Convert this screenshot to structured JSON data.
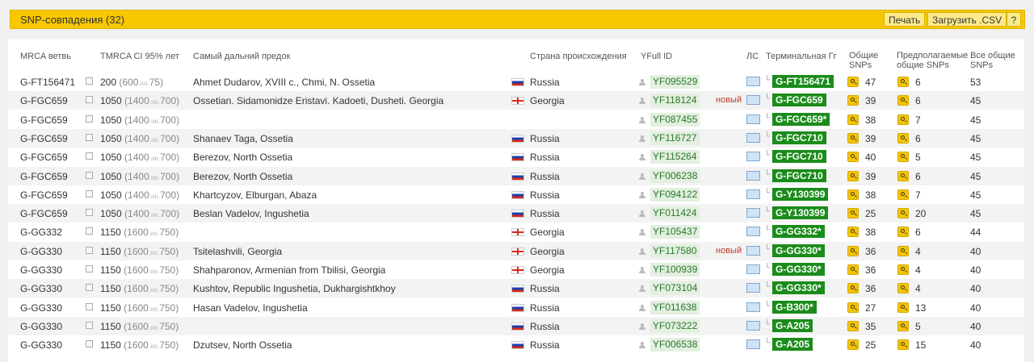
{
  "header": {
    "title": "SNP-совпадения (32)",
    "print_label": "Печать",
    "csv_label": "Загрузить .CSV",
    "help_label": "?"
  },
  "columns": {
    "mrca": "MRCA ветвь",
    "tmrca": "TMRCA CI 95% лет",
    "ancestor": "Самый дальний предок",
    "country": "Страна происхождения",
    "yfull": "YFull ID",
    "ls": "ЛС",
    "terminal": "Терминальная Гг",
    "shared1": "Общие",
    "shared2": "SNPs",
    "assumed1": "Предполагаемые",
    "assumed2": "общие SNPs",
    "all1": "Все общие",
    "all2": "SNPs"
  },
  "rows": [
    {
      "mrca": "G-FT156471",
      "tmrca": "200",
      "ci": "(600",
      "ci_end": "75)",
      "ancestor": "Ahmet Dudarov, XVIII c., Chmi, N. Ossetia",
      "country": "Russia",
      "flag": "ru",
      "yfull": "YF095529",
      "new": "",
      "hg": "G-FT156471",
      "shared": "47",
      "assumed": "6",
      "all": "53"
    },
    {
      "mrca": "G-FGC659",
      "tmrca": "1050",
      "ci": "(1400",
      "ci_end": "700)",
      "ancestor": "Ossetian. Sidamonidze Eristavi. Kadoeti, Dusheti. Georgia",
      "country": "Georgia",
      "flag": "ge",
      "yfull": "YF118124",
      "new": "новый",
      "hg": "G-FGC659",
      "shared": "39",
      "assumed": "6",
      "all": "45"
    },
    {
      "mrca": "G-FGC659",
      "tmrca": "1050",
      "ci": "(1400",
      "ci_end": "700)",
      "ancestor": "",
      "country": "",
      "flag": "",
      "yfull": "YF087455",
      "new": "",
      "hg": "G-FGC659*",
      "shared": "38",
      "assumed": "7",
      "all": "45"
    },
    {
      "mrca": "G-FGC659",
      "tmrca": "1050",
      "ci": "(1400",
      "ci_end": "700)",
      "ancestor": "Shanaev Taga, Ossetia",
      "country": "Russia",
      "flag": "ru",
      "yfull": "YF116727",
      "new": "",
      "hg": "G-FGC710",
      "shared": "39",
      "assumed": "6",
      "all": "45"
    },
    {
      "mrca": "G-FGC659",
      "tmrca": "1050",
      "ci": "(1400",
      "ci_end": "700)",
      "ancestor": "Berezov, North Ossetia",
      "country": "Russia",
      "flag": "ru",
      "yfull": "YF115264",
      "new": "",
      "hg": "G-FGC710",
      "shared": "40",
      "assumed": "5",
      "all": "45"
    },
    {
      "mrca": "G-FGC659",
      "tmrca": "1050",
      "ci": "(1400",
      "ci_end": "700)",
      "ancestor": "Berezov, North Ossetia",
      "country": "Russia",
      "flag": "ru",
      "yfull": "YF006238",
      "new": "",
      "hg": "G-FGC710",
      "shared": "39",
      "assumed": "6",
      "all": "45"
    },
    {
      "mrca": "G-FGC659",
      "tmrca": "1050",
      "ci": "(1400",
      "ci_end": "700)",
      "ancestor": "Khartcyzov, Elburgan, Abaza",
      "country": "Russia",
      "flag": "ru",
      "yfull": "YF094122",
      "new": "",
      "hg": "G-Y130399",
      "shared": "38",
      "assumed": "7",
      "all": "45"
    },
    {
      "mrca": "G-FGC659",
      "tmrca": "1050",
      "ci": "(1400",
      "ci_end": "700)",
      "ancestor": "Beslan Vadelov, Ingushetia",
      "country": "Russia",
      "flag": "ru",
      "yfull": "YF011424",
      "new": "",
      "hg": "G-Y130399",
      "shared": "25",
      "assumed": "20",
      "all": "45"
    },
    {
      "mrca": "G-GG332",
      "tmrca": "1150",
      "ci": "(1600",
      "ci_end": "750)",
      "ancestor": "",
      "country": "Georgia",
      "flag": "ge",
      "yfull": "YF105437",
      "new": "",
      "hg": "G-GG332*",
      "shared": "38",
      "assumed": "6",
      "all": "44"
    },
    {
      "mrca": "G-GG330",
      "tmrca": "1150",
      "ci": "(1600",
      "ci_end": "750)",
      "ancestor": "Tsitelashvili, Georgia",
      "country": "Georgia",
      "flag": "ge",
      "yfull": "YF117580",
      "new": "новый",
      "hg": "G-GG330*",
      "shared": "36",
      "assumed": "4",
      "all": "40"
    },
    {
      "mrca": "G-GG330",
      "tmrca": "1150",
      "ci": "(1600",
      "ci_end": "750)",
      "ancestor": "Shahparonov, Armenian from Tbilisi, Georgia",
      "country": "Georgia",
      "flag": "ge",
      "yfull": "YF100939",
      "new": "",
      "hg": "G-GG330*",
      "shared": "36",
      "assumed": "4",
      "all": "40"
    },
    {
      "mrca": "G-GG330",
      "tmrca": "1150",
      "ci": "(1600",
      "ci_end": "750)",
      "ancestor": "Kushtov, Republic Ingushetia, Dukhargishtkhoy",
      "country": "Russia",
      "flag": "ru",
      "yfull": "YF073104",
      "new": "",
      "hg": "G-GG330*",
      "shared": "36",
      "assumed": "4",
      "all": "40"
    },
    {
      "mrca": "G-GG330",
      "tmrca": "1150",
      "ci": "(1600",
      "ci_end": "750)",
      "ancestor": "Hasan Vadelov, Ingushetia",
      "country": "Russia",
      "flag": "ru",
      "yfull": "YF011638",
      "new": "",
      "hg": "G-B300*",
      "shared": "27",
      "assumed": "13",
      "all": "40"
    },
    {
      "mrca": "G-GG330",
      "tmrca": "1150",
      "ci": "(1600",
      "ci_end": "750)",
      "ancestor": "",
      "country": "Russia",
      "flag": "ru",
      "yfull": "YF073222",
      "new": "",
      "hg": "G-A205",
      "shared": "35",
      "assumed": "5",
      "all": "40"
    },
    {
      "mrca": "G-GG330",
      "tmrca": "1150",
      "ci": "(1600",
      "ci_end": "750)",
      "ancestor": "Dzutsev, North Ossetia",
      "country": "Russia",
      "flag": "ru",
      "yfull": "YF006538",
      "new": "",
      "hg": "G-A205",
      "shared": "25",
      "assumed": "15",
      "all": "40"
    }
  ]
}
